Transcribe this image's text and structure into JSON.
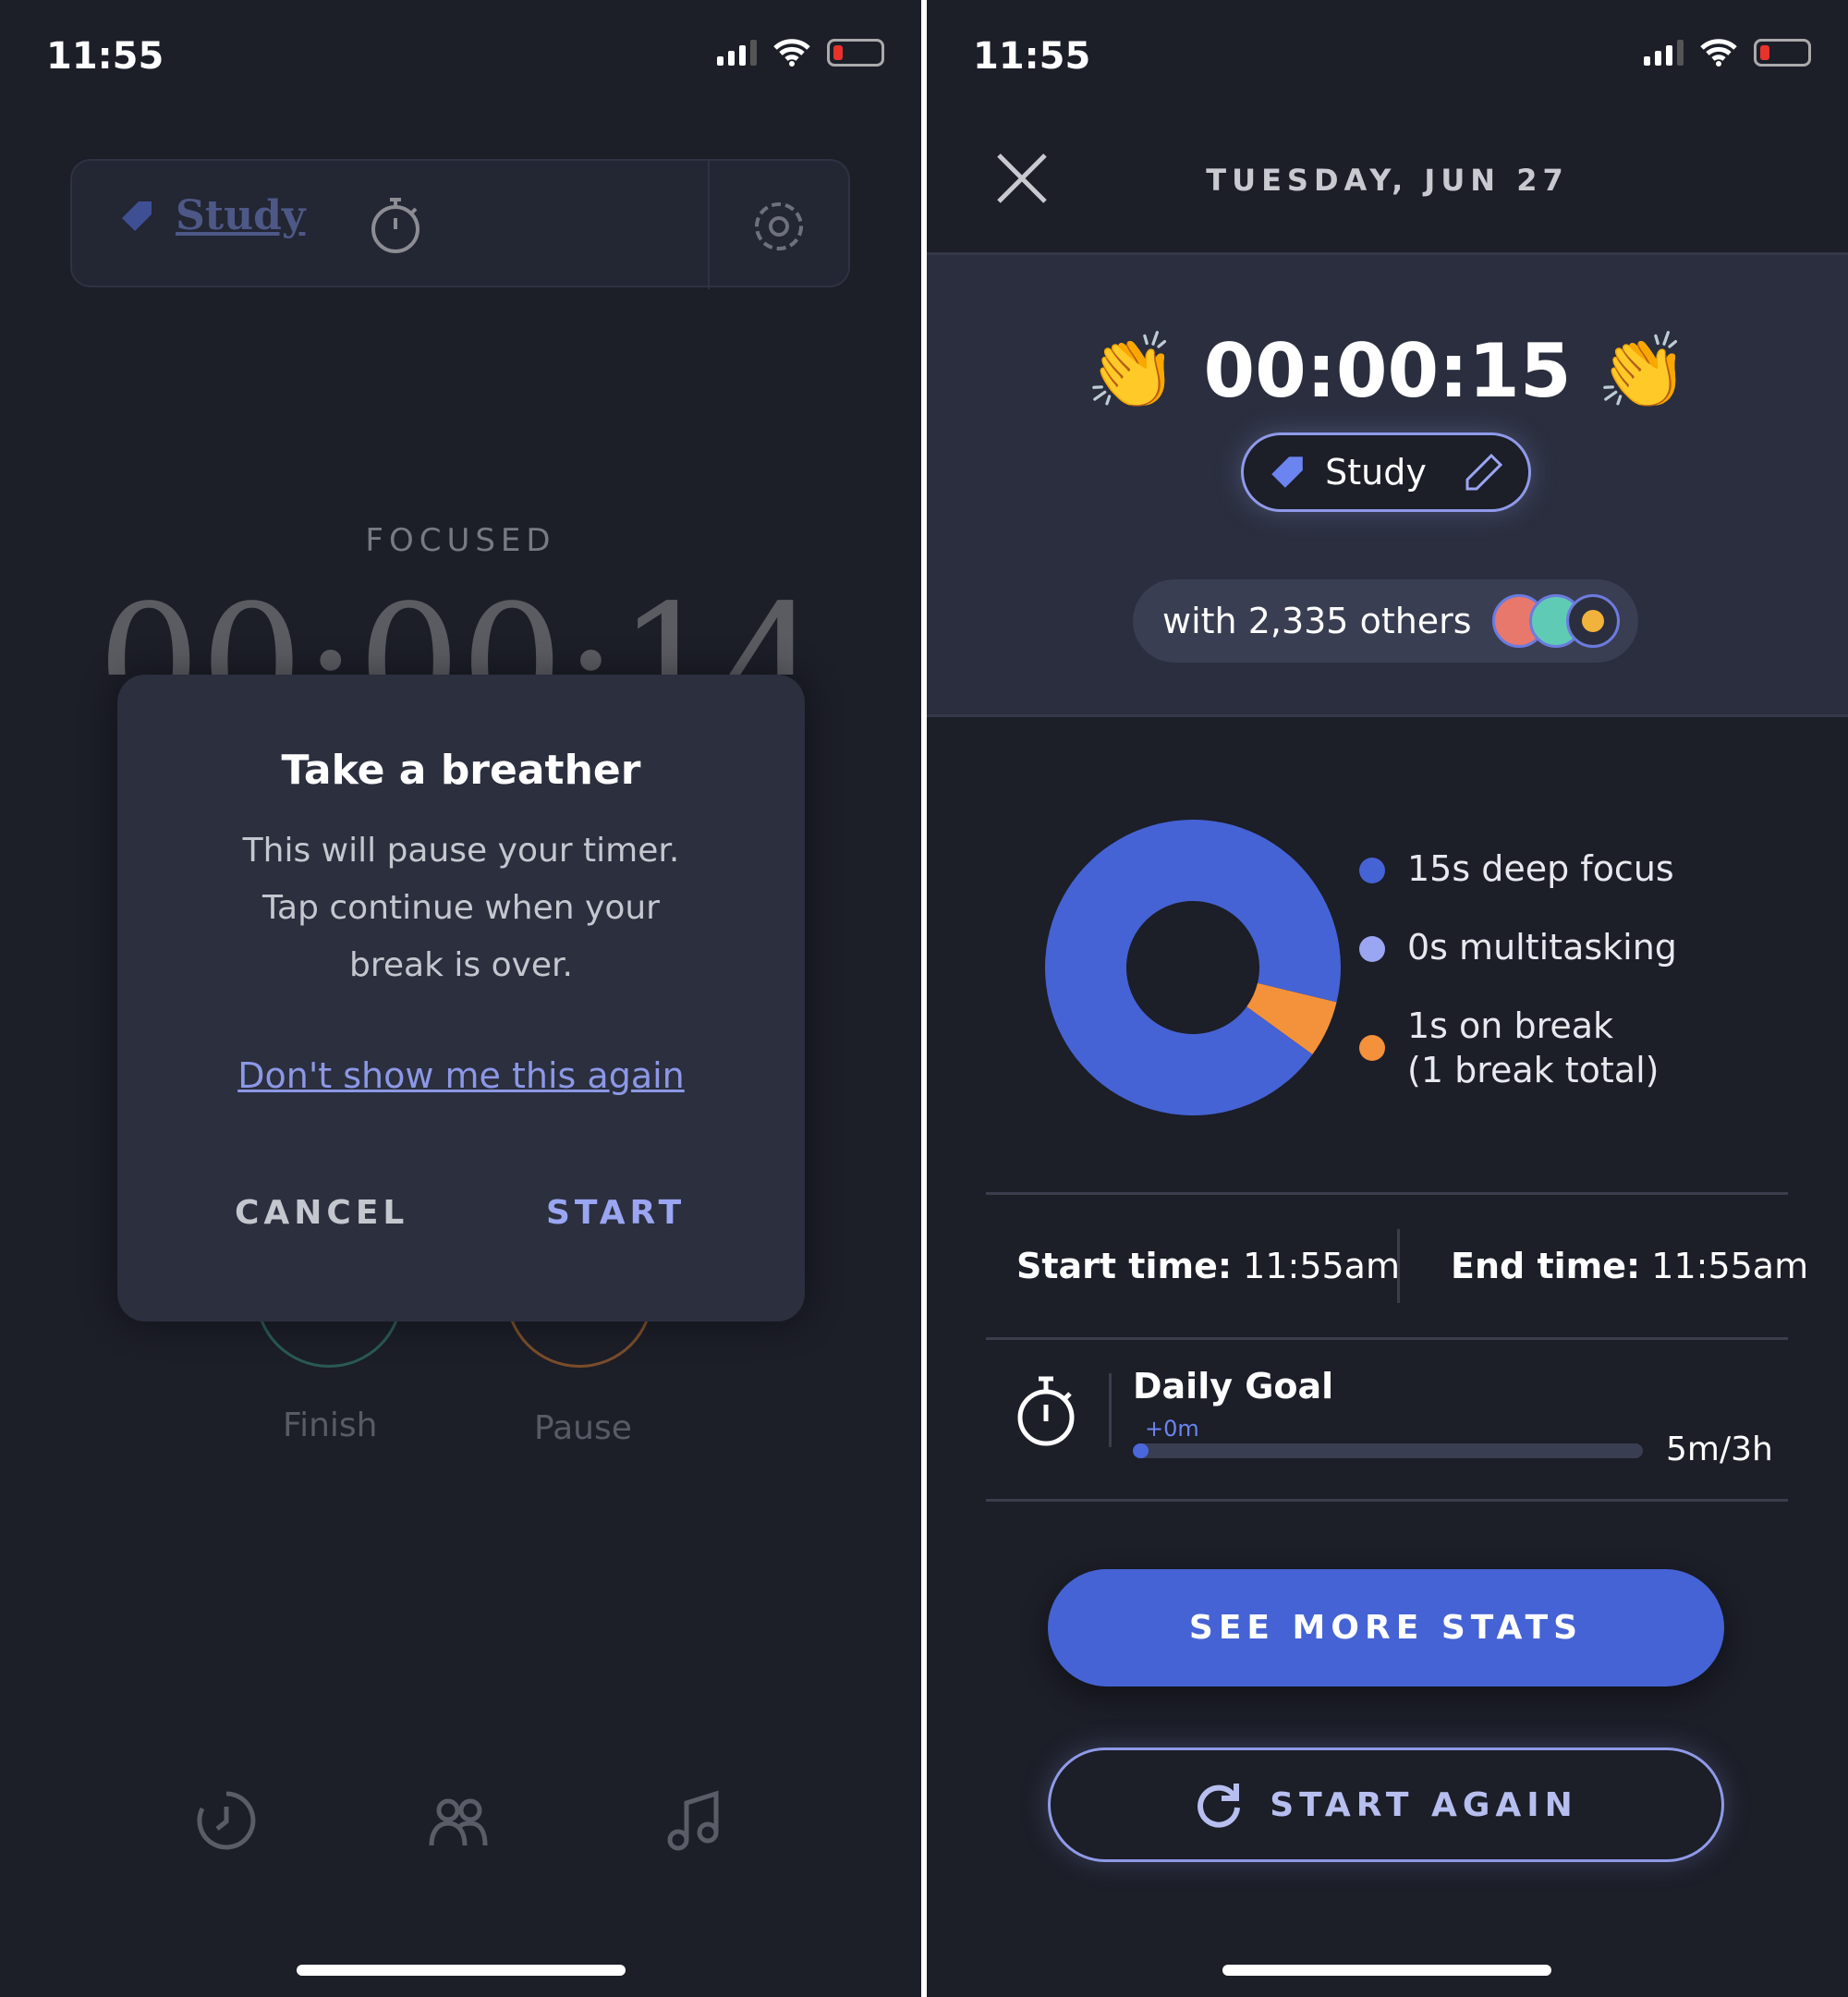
{
  "left": {
    "status": {
      "time": "11:55"
    },
    "header": {
      "tag": "Study"
    },
    "state_label": "FOCUSED",
    "timer": "00:00:14",
    "modal": {
      "title": "Take a breather",
      "body_lines": [
        "This will pause your timer.",
        "Tap continue when your",
        "break is over."
      ],
      "link": "Don't show me this again",
      "cancel": "CANCEL",
      "start": "START"
    },
    "actions": {
      "finish": "Finish",
      "pause": "Pause"
    },
    "nav": [
      "history-icon",
      "friends-icon",
      "music-icon"
    ]
  },
  "right": {
    "status": {
      "time": "11:55"
    },
    "date": "TUESDAY, JUN 27",
    "timer": "00:00:15",
    "tag": "Study",
    "others": "with 2,335 others",
    "chart_data": {
      "type": "pie",
      "series": [
        {
          "name": "deep focus",
          "values": [
            15
          ]
        },
        {
          "name": "multitasking",
          "values": [
            0
          ]
        },
        {
          "name": "on break",
          "values": [
            1
          ]
        }
      ],
      "colors": [
        "#4563d4",
        "#8f9ae8",
        "#f4913b"
      ]
    },
    "legend": [
      {
        "text": "15s deep focus",
        "color": "#4563d4"
      },
      {
        "text": "0s multitasking",
        "color": "#9aa6f2"
      },
      {
        "text": "1s on break",
        "text2": "(1 break total)",
        "color": "#f4913b"
      }
    ],
    "start_label": "Start time:",
    "start_value": " 11:55am",
    "end_label": "End time:",
    "end_value": " 11:55am",
    "goal": {
      "title": "Daily Goal",
      "delta": "+0m",
      "progress": "5m/3h",
      "fraction": 0.028
    },
    "see_more": "SEE MORE STATS",
    "start_again": "START AGAIN",
    "accent": "#4563d4"
  }
}
